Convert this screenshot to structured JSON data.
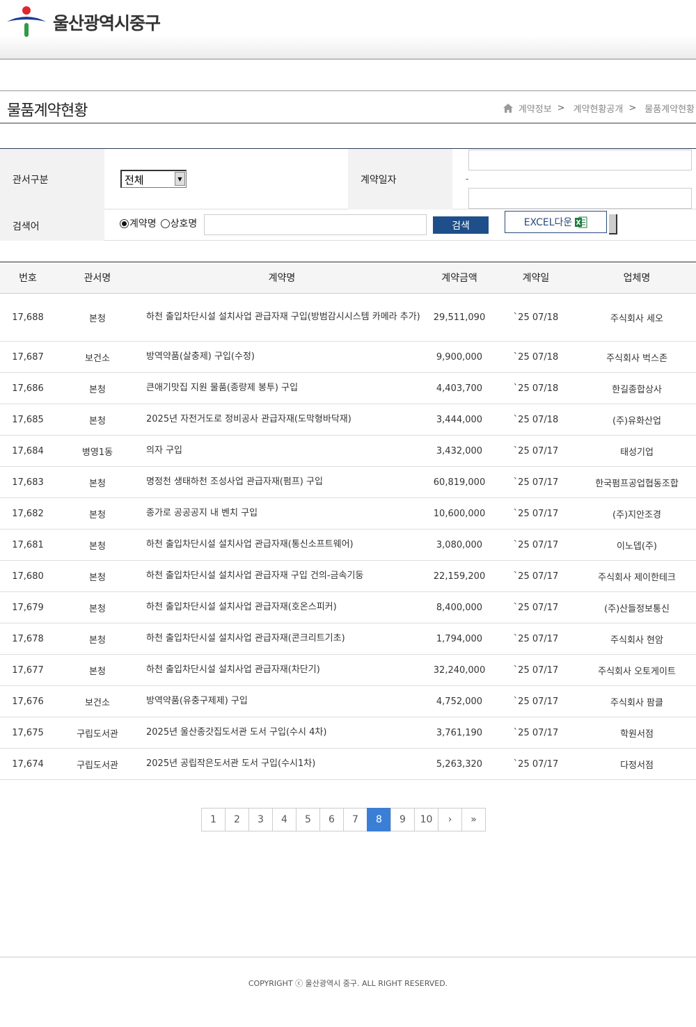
{
  "header": {
    "site_name": "울산광역시중구"
  },
  "title_bar": {
    "title": "물품계약현황",
    "breadcrumb": [
      {
        "label": "계약정보",
        "sep": ">"
      },
      {
        "label": "계약현황공개",
        "sep": ">"
      },
      {
        "label": "물품계약현황",
        "sep": ""
      }
    ]
  },
  "search": {
    "dept_label": "관서구분",
    "dept_selected": "전체",
    "date_label": "계약일자",
    "date_sep": "-",
    "keyword_label": "검색어",
    "radio_options": [
      {
        "label": "계약명",
        "checked": true
      },
      {
        "label": "상호명",
        "checked": false
      }
    ],
    "search_button": "검색",
    "excel_button": "EXCEL다운"
  },
  "table": {
    "columns": [
      "번호",
      "관서명",
      "계약명",
      "계약금액",
      "계약일",
      "업체명"
    ],
    "rows": [
      {
        "no": "17,688",
        "dept": "본청",
        "name": "하천 출입차단시설 설치사업 관급자재 구입(방범감시시스템 카메라 추가)",
        "amount": "29,511,090",
        "date": "`25 07/18",
        "vendor": "주식회사 세오"
      },
      {
        "no": "17,687",
        "dept": "보건소",
        "name": "방역약품(살충제) 구입(수정)",
        "amount": "9,900,000",
        "date": "`25 07/18",
        "vendor": "주식회사 벅스존"
      },
      {
        "no": "17,686",
        "dept": "본청",
        "name": "큰애기맛집 지원 물품(종량제 봉투) 구입",
        "amount": "4,403,700",
        "date": "`25 07/18",
        "vendor": "한길종합상사"
      },
      {
        "no": "17,685",
        "dept": "본청",
        "name": "2025년 자전거도로 정비공사 관급자재(도막형바닥재)",
        "amount": "3,444,000",
        "date": "`25 07/18",
        "vendor": "(주)유화산업"
      },
      {
        "no": "17,684",
        "dept": "병영1동",
        "name": "의자 구입",
        "amount": "3,432,000",
        "date": "`25 07/17",
        "vendor": "태성기업"
      },
      {
        "no": "17,683",
        "dept": "본청",
        "name": "명정천 생태하천 조성사업 관급자재(펌프) 구입",
        "amount": "60,819,000",
        "date": "`25 07/17",
        "vendor": "한국펌프공업협동조합"
      },
      {
        "no": "17,682",
        "dept": "본청",
        "name": "종가로 공공공지 내 벤치 구입",
        "amount": "10,600,000",
        "date": "`25 07/17",
        "vendor": "(주)지안조경"
      },
      {
        "no": "17,681",
        "dept": "본청",
        "name": "하천 출입차단시설 설치사업 관급자재(통신소프트웨어)",
        "amount": "3,080,000",
        "date": "`25 07/17",
        "vendor": "이노뎁(주)"
      },
      {
        "no": "17,680",
        "dept": "본청",
        "name": "하천 출입차단시설 설치사업 관급자재 구입 건의-금속기둥",
        "amount": "22,159,200",
        "date": "`25 07/17",
        "vendor": "주식회사 제이한테크"
      },
      {
        "no": "17,679",
        "dept": "본청",
        "name": "하천 출입차단시설 설치사업 관급자재(호온스피커)",
        "amount": "8,400,000",
        "date": "`25 07/17",
        "vendor": "(주)산들정보통신"
      },
      {
        "no": "17,678",
        "dept": "본청",
        "name": "하천 출입차단시설 설치사업 관급자재(콘크리트기초)",
        "amount": "1,794,000",
        "date": "`25 07/17",
        "vendor": "주식회사 현암"
      },
      {
        "no": "17,677",
        "dept": "본청",
        "name": "하천 출입차단시설 설치사업 관급자재(차단기)",
        "amount": "32,240,000",
        "date": "`25 07/17",
        "vendor": "주식회사 오토게이트"
      },
      {
        "no": "17,676",
        "dept": "보건소",
        "name": "방역약품(유충구제제) 구입",
        "amount": "4,752,000",
        "date": "`25 07/17",
        "vendor": "주식회사 팜클"
      },
      {
        "no": "17,675",
        "dept": "구립도서관",
        "name": "2025년 울산종갓집도서관 도서 구입(수시 4차)",
        "amount": "3,761,190",
        "date": "`25 07/17",
        "vendor": "학원서점"
      },
      {
        "no": "17,674",
        "dept": "구립도서관",
        "name": "2025년 공립작은도서관 도서 구입(수시1차)",
        "amount": "5,263,320",
        "date": "`25 07/17",
        "vendor": "다정서점"
      }
    ]
  },
  "pagination": {
    "pages": [
      "1",
      "2",
      "3",
      "4",
      "5",
      "6",
      "7",
      "8",
      "9",
      "10"
    ],
    "current": "8",
    "next": "›",
    "last": "»"
  },
  "footer": {
    "copyright": "COPYRIGHT ⓒ 울산광역시 중구. ALL RIGHT RESERVED."
  },
  "colors": {
    "accent": "#3a7fd5",
    "search_button": "#1e4f8a",
    "logo_red": "#e0262e",
    "logo_blue": "#1c3f94",
    "logo_green": "#2e9b45"
  }
}
